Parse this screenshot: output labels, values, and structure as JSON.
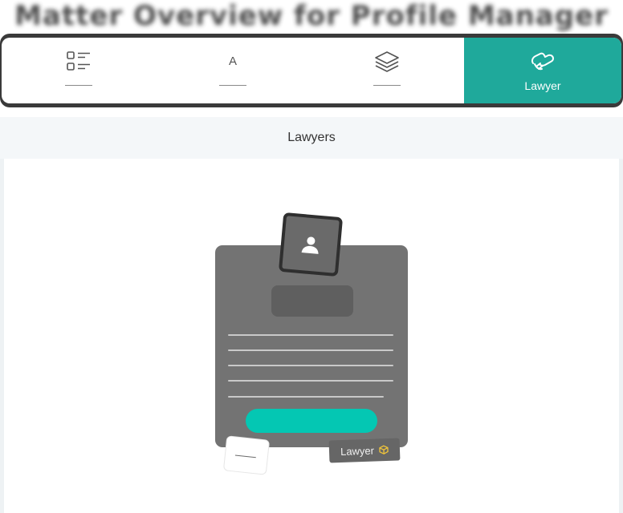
{
  "header": {
    "blurred_title": "Matter Overview for Profile Manager"
  },
  "tabs": [
    {
      "id": "list",
      "icon": "checklist-icon",
      "label": ""
    },
    {
      "id": "text",
      "icon": "letter-a-icon",
      "letter": "A",
      "label": ""
    },
    {
      "id": "layers",
      "icon": "layers-icon",
      "label": ""
    },
    {
      "id": "lawyer",
      "icon": "handshake-icon",
      "label": "Lawyer",
      "active": true
    }
  ],
  "panel": {
    "title": "Lawyers"
  },
  "illustration": {
    "tag_label": "Lawyer",
    "tag_icon": "cube-icon",
    "avatar_icon": "user-icon"
  },
  "colors": {
    "accent": "#1fa99b",
    "cta": "#04c7b3",
    "card": "#737373",
    "frame": "#3a3a3a"
  }
}
